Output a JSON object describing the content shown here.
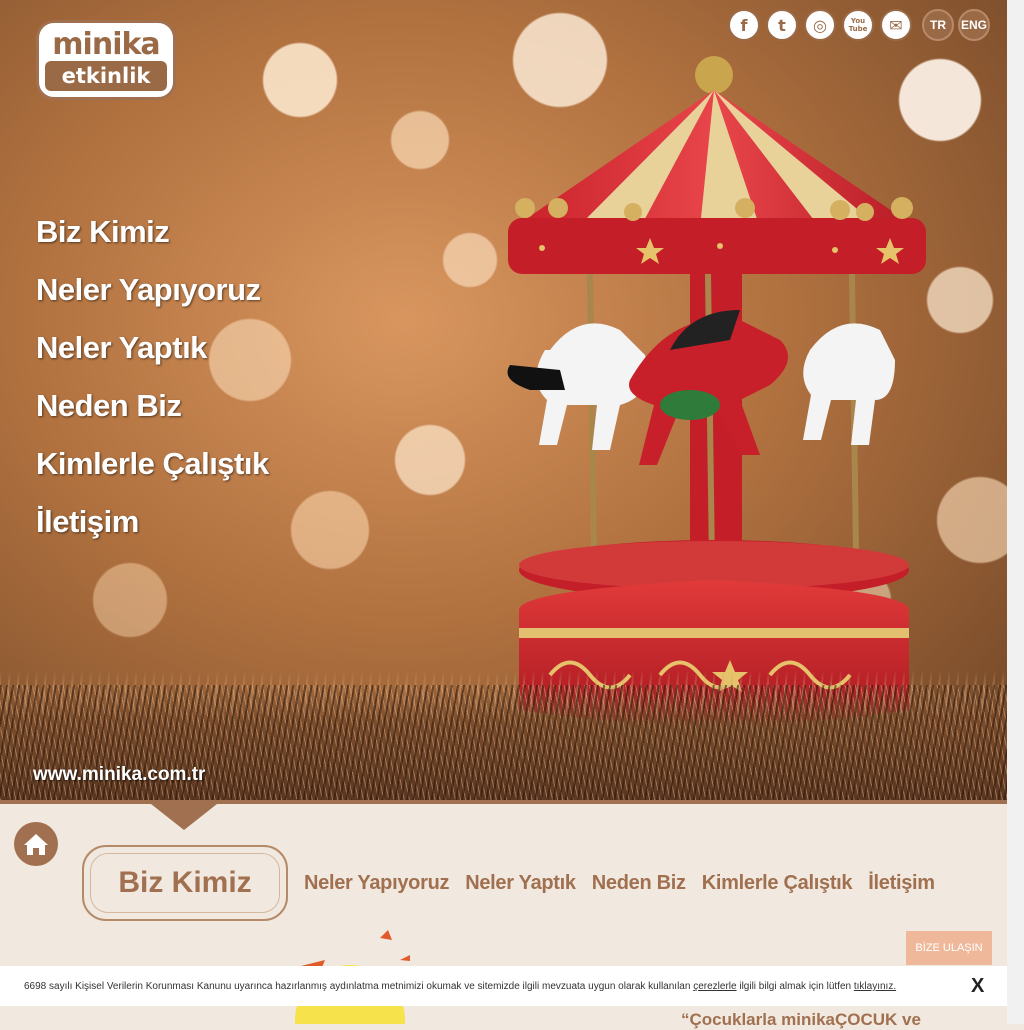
{
  "header": {
    "logo_line1": "minika",
    "logo_line2": "etkinlik",
    "social": [
      {
        "icon": "facebook-icon",
        "glyph": "f"
      },
      {
        "icon": "twitter-icon",
        "glyph": "t"
      },
      {
        "icon": "instagram-icon",
        "glyph": "◎"
      },
      {
        "icon": "youtube-icon",
        "glyph": "You Tube"
      },
      {
        "icon": "mail-icon",
        "glyph": "✉"
      }
    ],
    "languages": [
      "TR",
      "ENG"
    ]
  },
  "hero": {
    "menu": [
      "Biz Kimiz",
      "Neler Yapıyoruz",
      "Neler Yaptık",
      "Neden Biz",
      "Kimlerle Çalıştık",
      "İletişim"
    ],
    "url": "www.minika.com.tr"
  },
  "subnav": {
    "active": "Biz Kimiz",
    "items": [
      "Neler Yapıyoruz",
      "Neler Yaptık",
      "Neden Biz",
      "Kimlerle Çalıştık",
      "İletişim"
    ]
  },
  "contact_button": "BİZE ULAŞIN",
  "cookie": {
    "text_before": "6698 sayılı Kişisel Verilerin Korunması Kanunu uyarınca hazırlanmış aydınlatma metnimizi okumak ve sitemizde ilgili mevzuata uygun olarak kullanılan ",
    "link1": "çerezlerle",
    "text_middle": " ilgili bilgi almak için lütfen ",
    "link2": "tıklayınız.",
    "close": "X"
  },
  "quote_fragment": "“Çocuklarla minikaÇOCUK ve",
  "colors": {
    "brand_brown": "#a07050",
    "background": "#f1e9df",
    "button": "#f0b89a"
  }
}
